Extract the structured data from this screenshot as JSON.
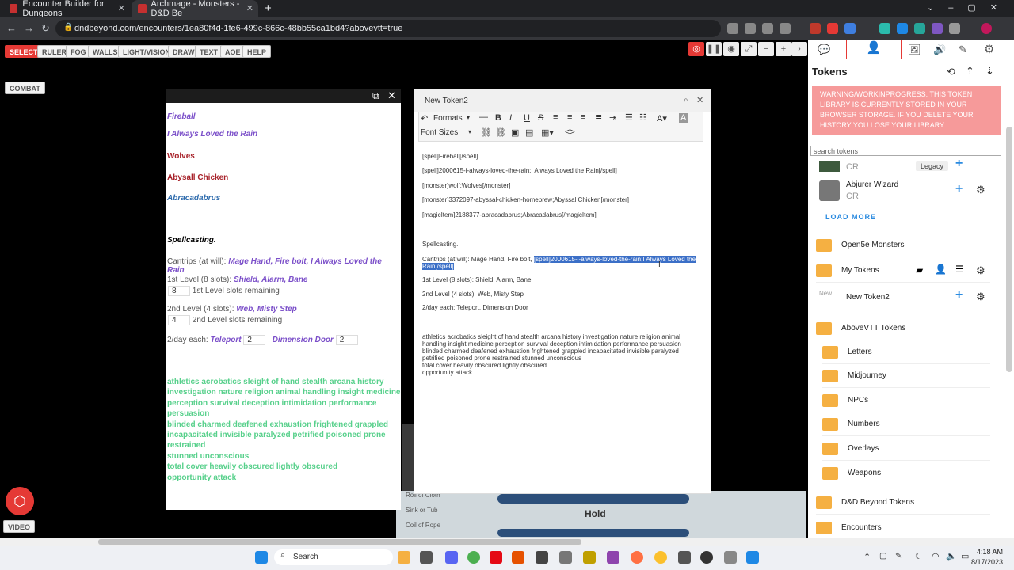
{
  "browser": {
    "tabs": [
      {
        "title": "Encounter Builder for Dungeons"
      },
      {
        "title": "Archmage - Monsters - D&D Be"
      }
    ],
    "new_tab": "+",
    "url": "dndbeyond.com/encounters/1ea80f4d-1fe6-499c-866c-48bb55ca1bd4?abovevtt=true"
  },
  "vtt_toolbar": [
    "SELECT",
    "RULER",
    "FOG",
    "WALLS",
    "LIGHT/VISION",
    "DRAW",
    "TEXT",
    "AOE",
    "HELP"
  ],
  "combat_label": "COMBAT",
  "video_label": "VIDEO",
  "stat_block": {
    "spells": [
      "Fireball",
      "I Always Loved the Rain"
    ],
    "monster": "Wolves",
    "monster2": "Abysall Chicken",
    "magic_item": "Abracadabrus",
    "spellcasting": "Spellcasting.",
    "cantrips_prefix": "Cantrips (at will):",
    "cantrips": "Mage Hand, Fire bolt, I Always Loved the Rain",
    "l1_prefix": "1st Level (8 slots):",
    "l1_spells": "Shield, Alarm, Bane",
    "l1_slots": "8",
    "l1_note": "1st Level slots remaining",
    "l2_prefix": "2nd Level (4 slots):",
    "l2_spells": "Web, Misty Step",
    "l2_slots": "4",
    "l2_note": "2nd Level slots remaining",
    "day_prefix": "2/day each:",
    "day_spell1": "Teleport",
    "day_v1": "2",
    "day_spell2": "Dimension Door",
    "day_v2": "2",
    "green_lines": [
      "athletics acrobatics sleight of hand stealth arcana history",
      "investigation nature religion animal handling insight medicine",
      "perception survival deception intimidation performance persuasion",
      "blinded charmed deafened exhaustion frightened grappled",
      "incapacitated invisible paralyzed petrified poisoned prone restrained",
      "stunned unconscious",
      "total cover heavily obscured lightly obscured",
      "opportunity attack"
    ]
  },
  "editor": {
    "title": "New Token2",
    "formats": "Formats",
    "font_sizes": "Font Sizes",
    "lines": [
      "[spell]Fireball[/spell]",
      "[spell]2000615-i-always-loved-the-rain;I Always Loved the Rain[/spell]",
      "[monster]wolf;Wolves[/monster]",
      "[monster]3372097-abyssal-chicken-homebrew;Abyssal Chicken[/monster]",
      "[magicItem]2188377-abracadabrus;Abracadabrus[/magicItem]"
    ],
    "spellcasting": "Spellcasting.",
    "cantrip_line": "Cantrips (at will): Mage Hand, Fire bolt,",
    "highlight1": "[spell]2000615-i-always-loved-the-rain;I Always Loved the",
    "highlight2": "Rain[/spell]",
    "l1": "1st Level (8 slots): Shield, Alarm, Bane",
    "l2": "2nd Level (4 slots): Web, Misty Step",
    "day": "2/day each: Teleport, Dimension Door",
    "para": [
      "athletics acrobatics sleight of hand stealth arcana history investigation nature religion animal",
      "handling insight medicine perception survival deception intimidation performance persuasion",
      "blinded charmed deafened exhaustion frightened grappled incapacitated invisible paralyzed",
      "petrified poisoned prone restrained stunned unconscious",
      "total cover heavily obscured lightly obscured",
      "opportunity attack"
    ]
  },
  "map_items": [
    "Roll of Cloth",
    "Sink or Tub",
    "Coil of Rope"
  ],
  "map_label": "Hold",
  "sidebar": {
    "title": "Tokens",
    "warning": "WARNING/WORKINPROGRESS: THIS TOKEN LIBRARY IS CURRENTLY STORED IN YOUR BROWSER STORAGE. IF YOU DELETE YOUR HISTORY YOU LOSE YOUR LIBRARY",
    "search_placeholder": "search tokens",
    "cr": "CR",
    "legacy": "Legacy",
    "abjurer": "Abjurer Wizard",
    "load_more": "LOAD MORE",
    "new_placeholder": "New",
    "folders": [
      "Open5e Monsters",
      "My Tokens",
      "New Token2",
      "AboveVTT Tokens",
      "Letters",
      "Midjourney",
      "NPCs",
      "Numbers",
      "Overlays",
      "Weapons",
      "D&D Beyond Tokens",
      "Encounters"
    ]
  },
  "taskbar": {
    "search": "Search",
    "time": "4:18 AM",
    "date": "8/17/2023"
  }
}
